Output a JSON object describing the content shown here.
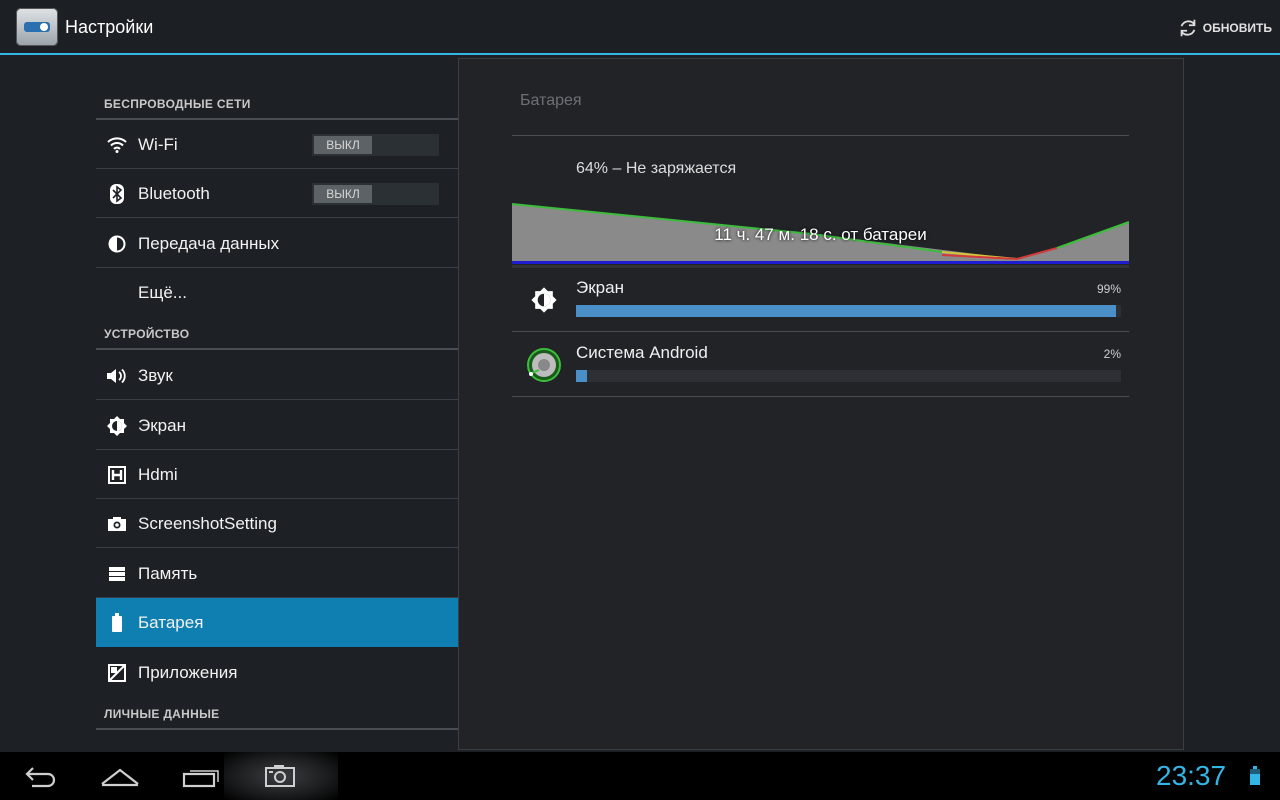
{
  "actionbar": {
    "title": "Настройки",
    "refresh_label": "ОБНОВИТЬ"
  },
  "sidebar": {
    "sections": {
      "wireless": "БЕСПРОВОДНЫЕ СЕТИ",
      "device": "УСТРОЙСТВО",
      "personal": "ЛИЧНЫЕ ДАННЫЕ"
    },
    "items": [
      {
        "label": "Wi-Fi",
        "icon": "wifi-icon",
        "toggle": "ВЫКЛ"
      },
      {
        "label": "Bluetooth",
        "icon": "bluetooth-icon",
        "toggle": "ВЫКЛ"
      },
      {
        "label": "Передача данных",
        "icon": "data-usage-icon"
      },
      {
        "label": "Ещё...",
        "icon": ""
      },
      {
        "label": "Звук",
        "icon": "speaker-icon"
      },
      {
        "label": "Экран",
        "icon": "brightness-icon"
      },
      {
        "label": "Hdmi",
        "icon": "hdmi-icon"
      },
      {
        "label": "ScreenshotSetting",
        "icon": "camera-icon"
      },
      {
        "label": "Память",
        "icon": "storage-icon"
      },
      {
        "label": "Батарея",
        "icon": "battery-icon",
        "selected": true
      },
      {
        "label": "Приложения",
        "icon": "apps-icon"
      }
    ]
  },
  "battery": {
    "title": "Батарея",
    "status": "64% – Не заряжается",
    "graph_label": "11 ч. 47 м. 18 с. от батареи",
    "usage": [
      {
        "name": "Экран",
        "percent_label": "99%",
        "percent": 99,
        "icon": "brightness-icon"
      },
      {
        "name": "Система Android",
        "percent_label": "2%",
        "percent": 2,
        "icon": "android-system-icon"
      }
    ]
  },
  "statusbar": {
    "time": "23:37"
  },
  "colors": {
    "accent": "#33b5e5",
    "selected": "#0e7fb0",
    "usage_bar": "#4a8fc7"
  }
}
